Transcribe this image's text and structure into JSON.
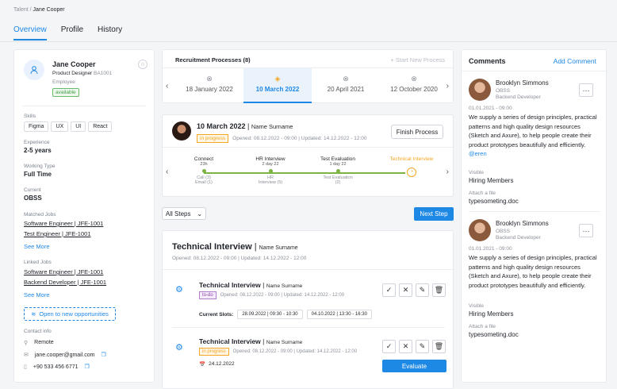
{
  "breadcrumb": {
    "root": "Talent",
    "sep": "/",
    "current": "Jane Cooper"
  },
  "tabs": [
    "Overview",
    "Profile",
    "History"
  ],
  "profile": {
    "name": "Jane Cooper",
    "title": "Product Designer",
    "code": "BA1001",
    "role": "Employee",
    "status": "available"
  },
  "skills": {
    "label": "Skills",
    "items": [
      "Figma",
      "UX",
      "UI",
      "React"
    ]
  },
  "experience": {
    "label": "Experience",
    "value": "2-5 years"
  },
  "working_type": {
    "label": "Working Type",
    "value": "Full Time"
  },
  "current": {
    "label": "Current",
    "value": "OBSS"
  },
  "matched_jobs": {
    "label": "Matched Jobs",
    "items": [
      "Software Engineer | JFE-1001",
      "Test Engineer | JFE-1001"
    ],
    "see_more": "See More"
  },
  "linked_jobs": {
    "label": "Linked Jobs",
    "items": [
      "Software Engineer | JFE-1001",
      "Backend Developer | JFE-1001"
    ],
    "see_more": "See More"
  },
  "open_btn": "Open to new opportunities",
  "contact": {
    "label": "Contact info",
    "location": "Remote",
    "email": "jane.cooper@gmail.com",
    "phone": "+90 533 456 6771"
  },
  "recruitment": {
    "title": "Recruitment Processes (8)",
    "start_new": "+ Start New Process",
    "dates": [
      "18 January 2022",
      "10 March 2022",
      "20 April 2021",
      "12 October 2020"
    ]
  },
  "process": {
    "date": "10 March 2022",
    "sep": " | ",
    "name": "Name Surname",
    "status": "in progress",
    "opened": "Opened: 08.12.2022 - 09:00 | Updated: 14.12.2022 - 12:00",
    "finish": "Finish Process"
  },
  "stages": [
    {
      "name": "Connect",
      "days": "23h",
      "detail1": "Call (3)",
      "detail2": "Email (1)"
    },
    {
      "name": "HR Interview",
      "days": "2 day 22",
      "detail1": "HR",
      "detail2": "Interview (5)"
    },
    {
      "name": "Test Evaluation",
      "days": "1 day 22",
      "detail1": "Test Evaluation",
      "detail2": "(2)"
    },
    {
      "name": "Technical Interview",
      "days": "",
      "detail1": "",
      "detail2": ""
    }
  ],
  "all_steps": "All Steps",
  "next_step": "Next Step",
  "tech": {
    "title": "Technical Interview",
    "sep": " | ",
    "name": "Name Surname",
    "opened": "Opened: 08.12.2022 - 09:00 | Updated: 14.12.2022 - 12:00"
  },
  "steps": [
    {
      "title": "Technical Interview",
      "sep": " | ",
      "name": "Name Surname",
      "status": "to-do",
      "opened": "Opened: 08.12.2022 - 09:00 | Updated: 14.12.2022 - 12:00",
      "slots_label": "Current Slots:",
      "slots": [
        "28.09.2022 | 09:30 - 10:30",
        "04.10.2022 | 13:30 - 16:30"
      ]
    },
    {
      "title": "Technical Interview",
      "sep": " | ",
      "name": "Name Surname",
      "status": "in progress",
      "opened": "Opened: 08.12.2022 - 09:00 | Updated: 14.12.2022 - 12:00",
      "date": "24.12.2022",
      "action": "Evaluate"
    }
  ],
  "comments": {
    "title": "Comments",
    "add": "Add Comment",
    "items": [
      {
        "author": "Brooklyn Simmons",
        "company": "OBSS",
        "role": "Backend Developer",
        "time": "01.01.2021 - 09:00",
        "text": "We supply a series of design principles, practical patterns and high quality design resources (Sketch and Axure), to help people create their product prototypes beautifully and efficiently.",
        "mention": "@eren",
        "visible_label": "Visible",
        "visible": "Hiring Members",
        "attach_label": "Attach a file",
        "file": "typesometing.doc"
      },
      {
        "author": "Brooklyn Simmons",
        "company": "OBSS",
        "role": "Backend Developer",
        "time": "01.01.2021 - 09:00",
        "text": "We supply a series of design principles, practical patterns and high quality design resources (Sketch and Axure), to help people create their product prototypes beautifully and efficiently.",
        "mention": "",
        "visible_label": "Visible",
        "visible": "Hiring Members",
        "attach_label": "Attach a file",
        "file": "typesometing.doc"
      }
    ]
  },
  "colors": {
    "accent": "#1e88e5",
    "progress_green": "#7cb342",
    "orange": "#f5a623",
    "purple": "#8e44ad"
  }
}
